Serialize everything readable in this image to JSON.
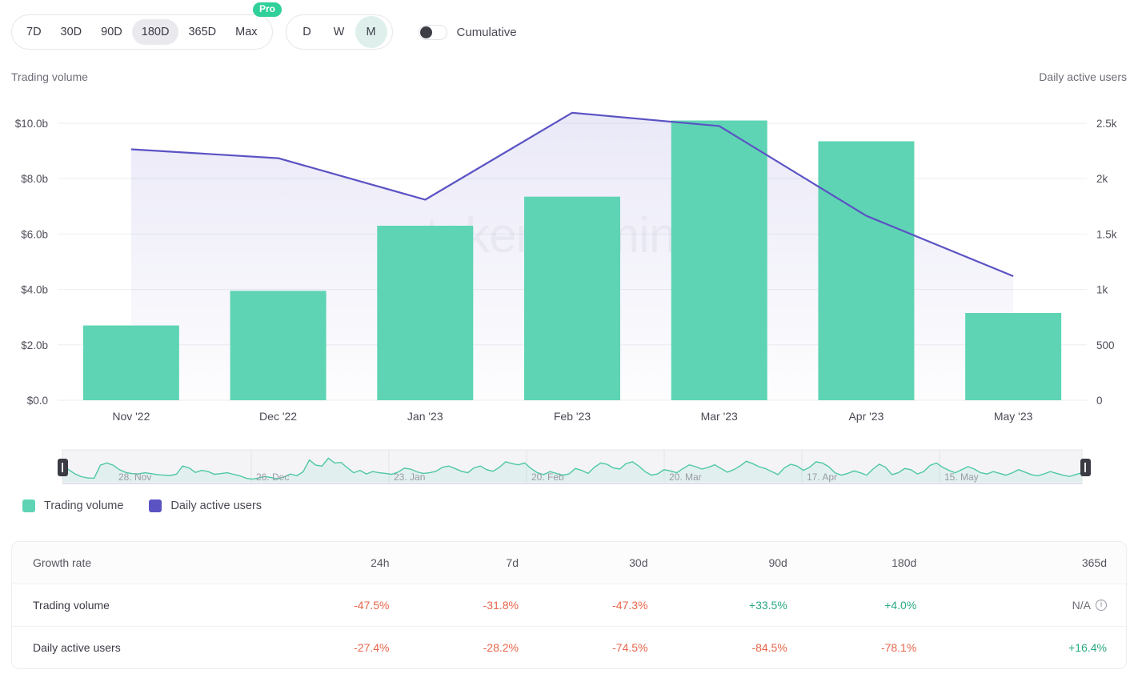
{
  "controls": {
    "ranges": [
      {
        "label": "7D",
        "active": false
      },
      {
        "label": "30D",
        "active": false
      },
      {
        "label": "90D",
        "active": false
      },
      {
        "label": "180D",
        "active": true
      },
      {
        "label": "365D",
        "active": false
      },
      {
        "label": "Max",
        "active": false
      }
    ],
    "pro_badge": "Pro",
    "granularity": [
      {
        "label": "D",
        "active": false
      },
      {
        "label": "W",
        "active": false
      },
      {
        "label": "M",
        "active": true
      }
    ],
    "cumulative_label": "Cumulative",
    "cumulative_on": false
  },
  "axis_captions": {
    "left": "Trading volume",
    "right": "Daily active users"
  },
  "legend": [
    {
      "label": "Trading volume",
      "color": "#5ed4b4"
    },
    {
      "label": "Daily active users",
      "color": "#5b53c4"
    }
  ],
  "watermark": "tokenterminal",
  "navigator": {
    "ticks": [
      "28. Nov",
      "26. Dec",
      "23. Jan",
      "20. Feb",
      "20. Mar",
      "17. Apr",
      "15. May"
    ]
  },
  "chart_data": {
    "type": "bar",
    "title": "",
    "xlabel": "",
    "ylabel": "Trading volume",
    "y2label": "Daily active users",
    "grid": true,
    "legend_position": "bottom-left",
    "categories": [
      "Nov '22",
      "Dec '22",
      "Jan '23",
      "Feb '23",
      "Mar '23",
      "Apr '23",
      "May '23"
    ],
    "ylim": [
      0,
      10000000000
    ],
    "y_tick_labels": [
      "$10.0b",
      "$8.0b",
      "$6.0b",
      "$4.0b",
      "$2.0b",
      "$0.0"
    ],
    "y_tick_values": [
      10000000000,
      8000000000,
      6000000000,
      4000000000,
      2000000000,
      0
    ],
    "y2lim": [
      0,
      2500
    ],
    "y2_tick_labels": [
      "2.5k",
      "2k",
      "1.5k",
      "1k",
      "500",
      "0"
    ],
    "y2_tick_values": [
      2500,
      2000,
      1500,
      1000,
      500,
      0
    ],
    "series": [
      {
        "name": "Trading volume",
        "type": "bar",
        "axis": "left",
        "color": "#5ed4b4",
        "values": [
          2700000000,
          3950000000,
          6300000000,
          7350000000,
          10100000000,
          9350000000,
          3150000000
        ],
        "display_values": [
          "$2.7b",
          "$3.95b",
          "$6.3b",
          "$7.35b",
          "$10.1b",
          "$9.35b",
          "$3.15b"
        ]
      },
      {
        "name": "Daily active users",
        "type": "line",
        "axis": "right",
        "color": "#5b53c4",
        "values": [
          2265,
          2185,
          1810,
          2595,
          2475,
          1665,
          1120
        ],
        "display_values": [
          "2265",
          "2185",
          "1810",
          "2595",
          "2475",
          "1665",
          "1120"
        ]
      }
    ]
  },
  "table": {
    "headers": [
      "Growth rate",
      "24h",
      "7d",
      "30d",
      "90d",
      "180d",
      "365d"
    ],
    "rows": [
      {
        "label": "Trading volume",
        "cells": [
          {
            "text": "-47.5%",
            "tone": "neg"
          },
          {
            "text": "-31.8%",
            "tone": "neg"
          },
          {
            "text": "-47.3%",
            "tone": "neg"
          },
          {
            "text": "+33.5%",
            "tone": "pos"
          },
          {
            "text": "+4.0%",
            "tone": "pos"
          },
          {
            "text": "N/A",
            "tone": "na",
            "info": true
          }
        ]
      },
      {
        "label": "Daily active users",
        "cells": [
          {
            "text": "-27.4%",
            "tone": "neg"
          },
          {
            "text": "-28.2%",
            "tone": "neg"
          },
          {
            "text": "-74.5%",
            "tone": "neg"
          },
          {
            "text": "-84.5%",
            "tone": "neg"
          },
          {
            "text": "-78.1%",
            "tone": "neg"
          },
          {
            "text": "+16.4%",
            "tone": "pos"
          }
        ]
      }
    ]
  }
}
